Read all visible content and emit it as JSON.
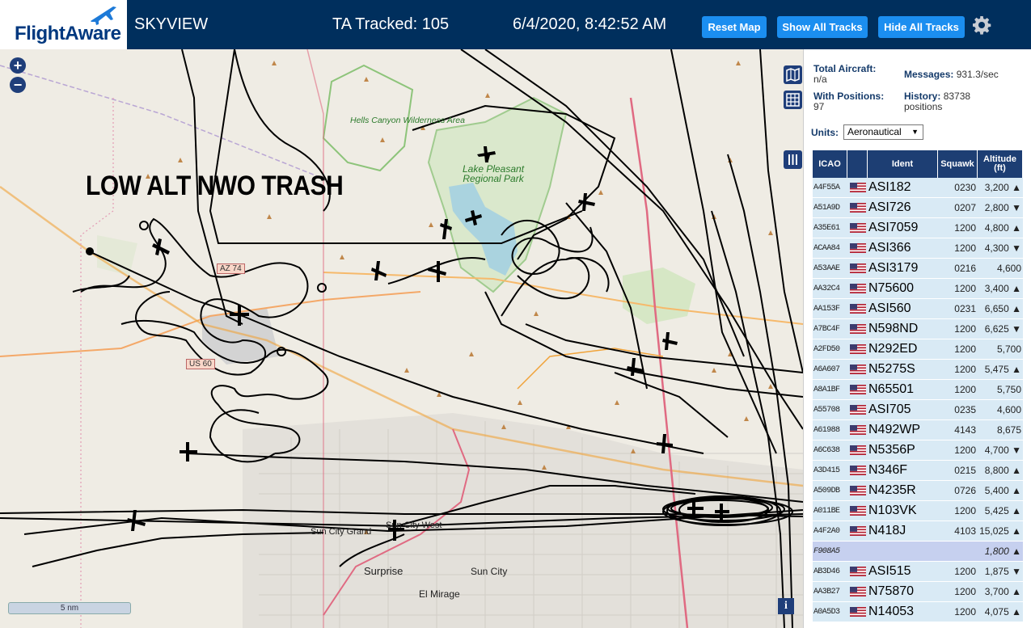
{
  "header": {
    "logo_text": "FlightAware",
    "app_title": "SKYVIEW",
    "tracked_label": "TA Tracked: 105",
    "datetime": "6/4/2020, 8:42:52 AM",
    "buttons": {
      "reset_map": "Reset Map",
      "show_all_tracks": "Show All Tracks",
      "hide_all_tracks": "Hide All Tracks"
    },
    "icons": {
      "logo": "plane-logo-icon",
      "settings": "gear-icon"
    }
  },
  "map": {
    "overlay_text": "LOW ALT NWO TRASH",
    "zoom_in": "+",
    "zoom_out": "−",
    "scale_label": "5 nm",
    "info_label": "i",
    "labels": {
      "hells_canyon": "Hells Canyon Wilderness Area",
      "lake_pleasant": "Lake Pleasant Regional Park",
      "sun_city_grand": "Sun City Grand",
      "sun_city_west": "Sun City West",
      "surprise": "Surprise",
      "sun_city": "Sun City",
      "el_mirage": "El Mirage",
      "az74": "AZ 74",
      "us60": "US 60"
    },
    "colors": {
      "land": "#efece4",
      "water": "#aad3df",
      "park": "#a5cf8c",
      "track": "#000000",
      "road": "#f0a33a"
    }
  },
  "panel": {
    "total_aircraft_label": "Total Aircraft:",
    "total_aircraft_value": "n/a",
    "with_positions_label": "With Positions:",
    "with_positions_value": "97",
    "messages_label": "Messages:",
    "messages_value": "931.3/sec",
    "history_label": "History:",
    "history_value": "83738",
    "history_unit": "positions",
    "units_label": "Units:",
    "units_value": "Aeronautical",
    "columns": [
      "ICAO",
      "Ident",
      "Squawk",
      "Altitude (ft)"
    ],
    "rows": [
      {
        "icao": "A4F55A",
        "ident": "ASI182",
        "squawk": "0230",
        "altitude": "3,200 ▲"
      },
      {
        "icao": "A51A9D",
        "ident": "ASI726",
        "squawk": "0207",
        "altitude": "2,800 ▼"
      },
      {
        "icao": "A35E61",
        "ident": "ASI7059",
        "squawk": "1200",
        "altitude": "4,800 ▲"
      },
      {
        "icao": "ACAA84",
        "ident": "ASI366",
        "squawk": "1200",
        "altitude": "4,300 ▼"
      },
      {
        "icao": "A53AAE",
        "ident": "ASI3179",
        "squawk": "0216",
        "altitude": "4,600"
      },
      {
        "icao": "AA32C4",
        "ident": "N75600",
        "squawk": "1200",
        "altitude": "3,400 ▲"
      },
      {
        "icao": "AA153F",
        "ident": "ASI560",
        "squawk": "0231",
        "altitude": "6,650 ▲"
      },
      {
        "icao": "A7BC4F",
        "ident": "N598ND",
        "squawk": "1200",
        "altitude": "6,625 ▼"
      },
      {
        "icao": "A2FD50",
        "ident": "N292ED",
        "squawk": "1200",
        "altitude": "5,700"
      },
      {
        "icao": "A6A607",
        "ident": "N5275S",
        "squawk": "1200",
        "altitude": "5,475 ▲"
      },
      {
        "icao": "A8A1BF",
        "ident": "N65501",
        "squawk": "1200",
        "altitude": "5,750"
      },
      {
        "icao": "A55708",
        "ident": "ASI705",
        "squawk": "0235",
        "altitude": "4,600"
      },
      {
        "icao": "A61988",
        "ident": "N492WP",
        "squawk": "4143",
        "altitude": "8,675"
      },
      {
        "icao": "A6C638",
        "ident": "N5356P",
        "squawk": "1200",
        "altitude": "4,700 ▼"
      },
      {
        "icao": "A3D415",
        "ident": "N346F",
        "squawk": "0215",
        "altitude": "8,800 ▲"
      },
      {
        "icao": "A509DB",
        "ident": "N4235R",
        "squawk": "0726",
        "altitude": "5,400 ▲"
      },
      {
        "icao": "A011BE",
        "ident": "N103VK",
        "squawk": "1200",
        "altitude": "5,425 ▲"
      },
      {
        "icao": "A4F2A0",
        "ident": "N418J",
        "squawk": "4103",
        "altitude": "15,025 ▲"
      },
      {
        "icao": "F908A5",
        "ident": "",
        "squawk": "",
        "altitude": "1,800 ▲",
        "selected": true,
        "no_flag": true
      },
      {
        "icao": "AB3D46",
        "ident": "ASI515",
        "squawk": "1200",
        "altitude": "1,875 ▼"
      },
      {
        "icao": "AA3B27",
        "ident": "N75870",
        "squawk": "1200",
        "altitude": "3,700 ▲"
      },
      {
        "icao": "A0A5D3",
        "ident": "N14053",
        "squawk": "1200",
        "altitude": "4,075 ▲"
      }
    ]
  }
}
